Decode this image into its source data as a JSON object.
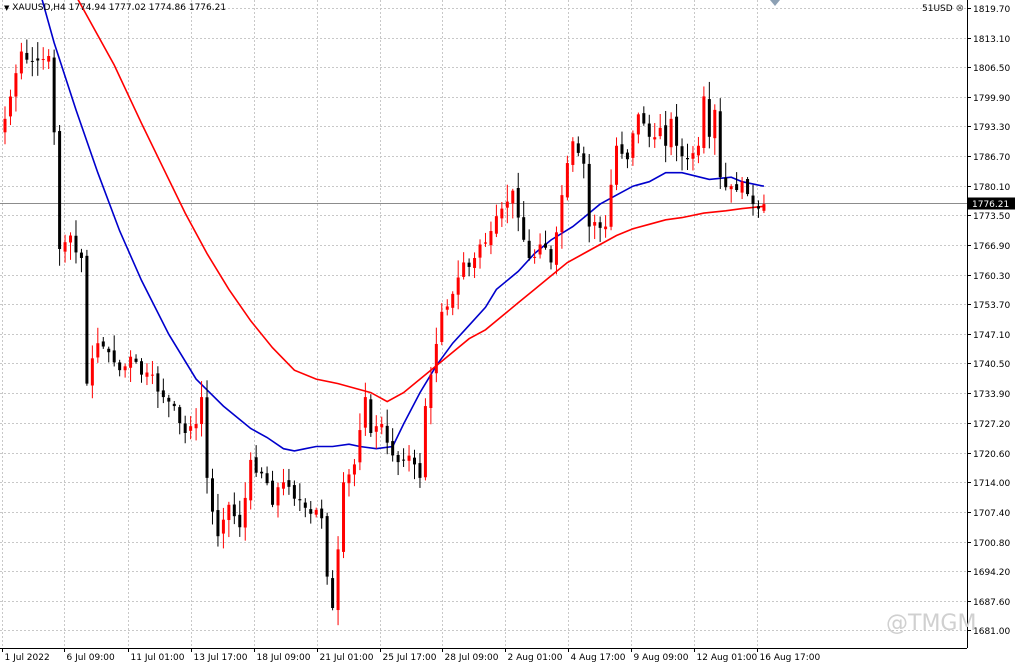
{
  "header": {
    "symbol_info": "XAUUSD,H4  1774.94 1777.02 1774.86 1776.21",
    "account_label": "51USD"
  },
  "watermark": "@TMGM",
  "colors": {
    "bull": "#ff0000",
    "bear": "#000000",
    "ma_fast": "#0000cc",
    "ma_slow": "#ff0000",
    "grid": "#c8c8c8",
    "price_line": "#8c8c8c",
    "price_tag_bg": "#000000",
    "price_tag_fg": "#ffffff"
  },
  "chart_data": {
    "type": "candlestick",
    "symbol": "XAUUSD",
    "timeframe": "H4",
    "ylim": [
      1681.1,
      1819.7
    ],
    "y_ticks": [
      "1819.70",
      "1813.10",
      "1806.50",
      "1799.90",
      "1793.30",
      "1786.70",
      "1780.10",
      "1773.50",
      "1766.90",
      "1760.30",
      "1753.70",
      "1747.10",
      "1740.50",
      "1733.90",
      "1727.20",
      "1720.60",
      "1714.00",
      "1707.40",
      "1700.80",
      "1694.20",
      "1687.60",
      "1681.00"
    ],
    "x_labels": [
      "1 Jul 2022",
      "6 Jul 09:00",
      "11 Jul 01:00",
      "13 Jul 17:00",
      "18 Jul 09:00",
      "21 Jul 01:00",
      "25 Jul 17:00",
      "28 Jul 09:00",
      "2 Aug 01:00",
      "4 Aug 17:00",
      "9 Aug 09:00",
      "12 Aug 01:00",
      "16 Aug 17:00"
    ],
    "last_price": "1776.21",
    "grid": true,
    "anchors": [
      [
        0,
        1795
      ],
      [
        3,
        1810
      ],
      [
        6,
        1808
      ],
      [
        8,
        1809
      ],
      [
        9,
        1792
      ],
      [
        10,
        1766
      ],
      [
        12,
        1769
      ],
      [
        14,
        1764
      ],
      [
        15,
        1736
      ],
      [
        17,
        1745
      ],
      [
        19,
        1743
      ],
      [
        21,
        1739
      ],
      [
        23,
        1742
      ],
      [
        25,
        1738
      ],
      [
        27,
        1738
      ],
      [
        29,
        1733
      ],
      [
        31,
        1731
      ],
      [
        33,
        1725
      ],
      [
        35,
        1727
      ],
      [
        36,
        1733
      ],
      [
        37,
        1715
      ],
      [
        39,
        1702
      ],
      [
        41,
        1709
      ],
      [
        43,
        1704
      ],
      [
        45,
        1719
      ],
      [
        47,
        1716
      ],
      [
        49,
        1709
      ],
      [
        51,
        1714
      ],
      [
        52,
        1713
      ],
      [
        54,
        1710
      ],
      [
        56,
        1707
      ],
      [
        58,
        1706
      ],
      [
        59,
        1693
      ],
      [
        60,
        1686
      ],
      [
        62,
        1714
      ],
      [
        64,
        1718
      ],
      [
        66,
        1733
      ],
      [
        67,
        1725
      ],
      [
        69,
        1727
      ],
      [
        71,
        1720
      ],
      [
        73,
        1719
      ],
      [
        75,
        1718
      ],
      [
        76,
        1715
      ],
      [
        77,
        1731
      ],
      [
        78,
        1738
      ],
      [
        80,
        1752
      ],
      [
        82,
        1756
      ],
      [
        84,
        1763
      ],
      [
        85,
        1762
      ],
      [
        87,
        1767
      ],
      [
        89,
        1770
      ],
      [
        91,
        1775
      ],
      [
        93,
        1779
      ],
      [
        94,
        1773
      ],
      [
        96,
        1764
      ],
      [
        98,
        1767
      ],
      [
        100,
        1763
      ],
      [
        102,
        1778
      ],
      [
        104,
        1790
      ],
      [
        106,
        1785
      ],
      [
        107,
        1771
      ],
      [
        108,
        1772
      ],
      [
        110,
        1771
      ],
      [
        112,
        1789
      ],
      [
        114,
        1786
      ],
      [
        116,
        1796
      ],
      [
        118,
        1791
      ],
      [
        120,
        1793
      ],
      [
        121,
        1789
      ],
      [
        122,
        1795
      ],
      [
        123,
        1789
      ],
      [
        125,
        1786
      ],
      [
        127,
        1789
      ],
      [
        128,
        1800
      ],
      [
        129,
        1791
      ],
      [
        130,
        1797
      ],
      [
        131,
        1782
      ],
      [
        133,
        1780
      ],
      [
        135,
        1781
      ],
      [
        137,
        1776
      ],
      [
        138,
        1775
      ],
      [
        139,
        1776
      ]
    ],
    "series": [
      {
        "name": "MA fast",
        "color": "#0000cc",
        "points": [
          [
            0,
            1840
          ],
          [
            6,
            1825
          ],
          [
            9,
            1812
          ],
          [
            13,
            1797
          ],
          [
            17,
            1783
          ],
          [
            21,
            1770
          ],
          [
            25,
            1759
          ],
          [
            30,
            1747
          ],
          [
            35,
            1737
          ],
          [
            40,
            1731
          ],
          [
            45,
            1726
          ],
          [
            48,
            1724
          ],
          [
            51,
            1721.5
          ],
          [
            53,
            1721
          ],
          [
            55,
            1721.5
          ],
          [
            57,
            1722
          ],
          [
            60,
            1722
          ],
          [
            63,
            1722.5
          ],
          [
            65,
            1722
          ],
          [
            68,
            1721.5
          ],
          [
            71,
            1722
          ],
          [
            73,
            1727
          ],
          [
            76,
            1734
          ],
          [
            79,
            1740
          ],
          [
            82,
            1745
          ],
          [
            85,
            1749
          ],
          [
            88,
            1753
          ],
          [
            90,
            1757
          ],
          [
            94,
            1761
          ],
          [
            97,
            1765
          ],
          [
            100,
            1768
          ],
          [
            104,
            1771
          ],
          [
            106,
            1773
          ],
          [
            109,
            1776
          ],
          [
            112,
            1778
          ],
          [
            115,
            1780
          ],
          [
            118,
            1781
          ],
          [
            121,
            1783
          ],
          [
            124,
            1783
          ],
          [
            129,
            1781.5
          ],
          [
            133,
            1782
          ],
          [
            135,
            1781
          ],
          [
            139,
            1780
          ]
        ]
      },
      {
        "name": "MA slow",
        "color": "#ff0000",
        "points": [
          [
            0,
            1850
          ],
          [
            6,
            1838
          ],
          [
            10,
            1829
          ],
          [
            15,
            1818
          ],
          [
            20,
            1807
          ],
          [
            25,
            1794
          ],
          [
            29,
            1784
          ],
          [
            33,
            1774
          ],
          [
            37,
            1765
          ],
          [
            41,
            1757
          ],
          [
            45,
            1750
          ],
          [
            49,
            1744
          ],
          [
            53,
            1739
          ],
          [
            57,
            1737
          ],
          [
            61,
            1736
          ],
          [
            64,
            1735
          ],
          [
            67,
            1734
          ],
          [
            70,
            1732
          ],
          [
            73,
            1734
          ],
          [
            76,
            1737
          ],
          [
            79,
            1740
          ],
          [
            82,
            1743
          ],
          [
            85,
            1746
          ],
          [
            88,
            1748
          ],
          [
            91,
            1751
          ],
          [
            94,
            1754
          ],
          [
            97,
            1757
          ],
          [
            100,
            1760
          ],
          [
            103,
            1763
          ],
          [
            106,
            1765
          ],
          [
            109,
            1767
          ],
          [
            112,
            1769
          ],
          [
            115,
            1770.5
          ],
          [
            118,
            1771.5
          ],
          [
            121,
            1772.5
          ],
          [
            124,
            1773
          ],
          [
            128,
            1774
          ],
          [
            132,
            1774.5
          ],
          [
            135,
            1775
          ],
          [
            139,
            1775.5
          ]
        ]
      }
    ]
  }
}
